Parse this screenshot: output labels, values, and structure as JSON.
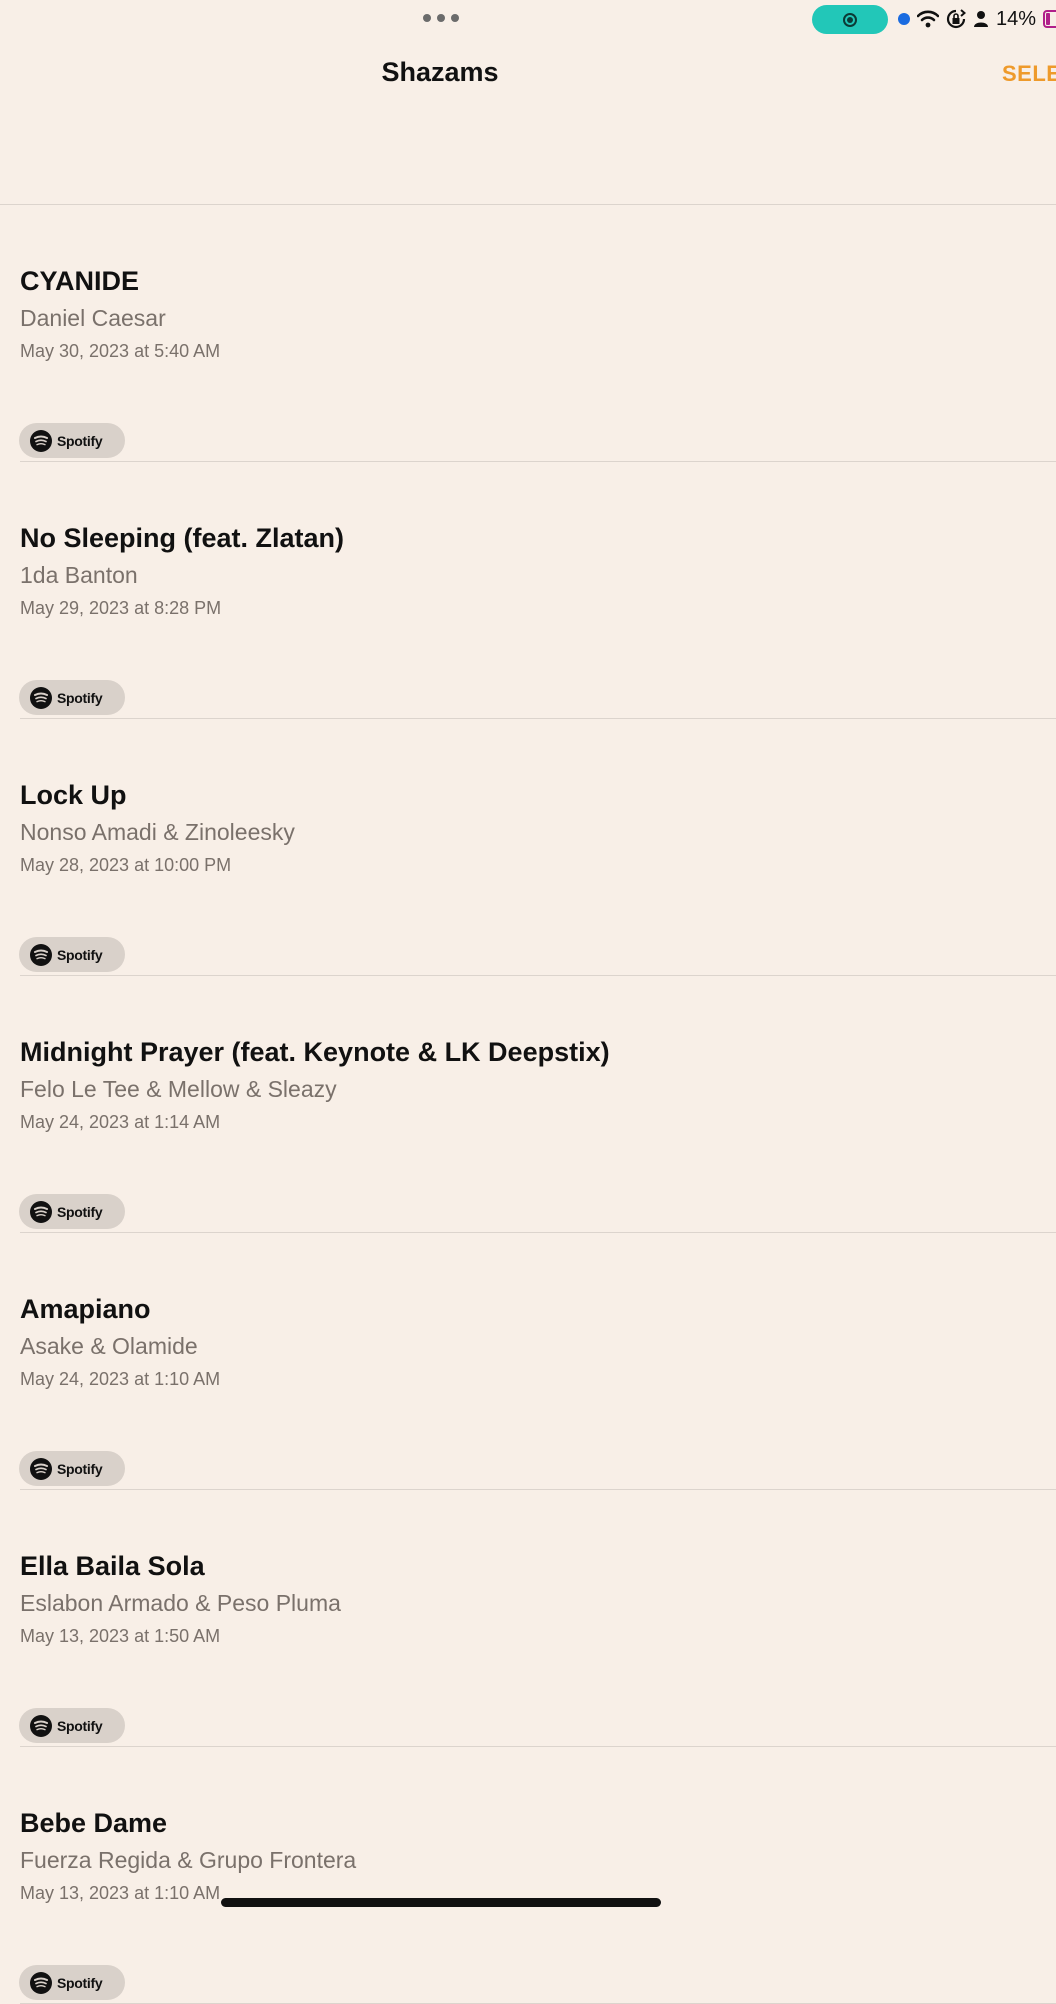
{
  "status_bar": {
    "battery_percent": "14%",
    "record_indicator_color": "#22c7b8",
    "icons": [
      "more-dots-icon",
      "screen-record-icon",
      "location-dot-icon",
      "wifi-icon",
      "rotation-lock-icon",
      "person-icon",
      "battery-icon"
    ]
  },
  "header": {
    "title": "Shazams",
    "select_label": "SELE"
  },
  "accent_color": "#ee9a2b",
  "items": [
    {
      "title": "CYANIDE",
      "artist": "Daniel Caesar",
      "date": "May 30, 2023 at 5:40 AM",
      "service": "Spotify"
    },
    {
      "title": "No Sleeping (feat. Zlatan)",
      "artist": "1da Banton",
      "date": "May 29, 2023 at 8:28 PM",
      "service": "Spotify"
    },
    {
      "title": "Lock Up",
      "artist": "Nonso Amadi & Zinoleesky",
      "date": "May 28, 2023 at 10:00 PM",
      "service": "Spotify"
    },
    {
      "title": "Midnight Prayer (feat. Keynote & LK Deepstix)",
      "artist": "Felo Le Tee & Mellow & Sleazy",
      "date": "May 24, 2023 at 1:14 AM",
      "service": "Spotify"
    },
    {
      "title": "Amapiano",
      "artist": "Asake & Olamide",
      "date": "May 24, 2023 at 1:10 AM",
      "service": "Spotify"
    },
    {
      "title": "Ella Baila Sola",
      "artist": "Eslabon Armado & Peso Pluma",
      "date": "May 13, 2023 at 1:50 AM",
      "service": "Spotify"
    },
    {
      "title": "Bebe Dame",
      "artist": "Fuerza Regida & Grupo Frontera",
      "date": "May 13, 2023 at 1:10 AM",
      "service": "Spotify"
    }
  ]
}
